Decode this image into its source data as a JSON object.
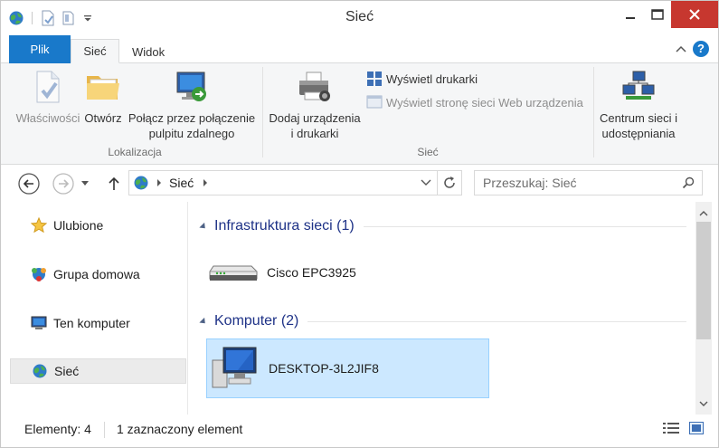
{
  "window": {
    "title": "Sieć"
  },
  "tabs": {
    "file": "Plik",
    "home": "Sieć",
    "view": "Widok"
  },
  "ribbon": {
    "properties": "Właściwości",
    "open": "Otwórz",
    "remote_desktop_line1": "Połącz przez połączenie",
    "remote_desktop_line2": "pulpitu zdalnego",
    "group_location": "Lokalizacja",
    "add_devices_line1": "Dodaj urządzenia",
    "add_devices_line2": "i drukarki",
    "view_printers": "Wyświetl drukarki",
    "view_device_webpage": "Wyświetl stronę sieci Web urządzenia",
    "group_network": "Sieć",
    "network_center_line1": "Centrum sieci i",
    "network_center_line2": "udostępniania"
  },
  "address": {
    "crumb": "Sieć"
  },
  "search": {
    "placeholder": "Przeszukaj: Sieć"
  },
  "navigation": {
    "favorites": "Ulubione",
    "homegroup": "Grupa domowa",
    "this_pc": "Ten komputer",
    "network": "Sieć"
  },
  "content": {
    "groups": [
      {
        "title": "Infrastruktura sieci (1)",
        "items": [
          "Cisco EPC3925"
        ]
      },
      {
        "title": "Komputer (2)",
        "items": [
          "DESKTOP-3L2JIF8"
        ]
      }
    ]
  },
  "status": {
    "count": "Elementy: 4",
    "selected": "1 zaznaczony element"
  },
  "colors": {
    "accent": "#1979ca",
    "selection": "#cce8ff",
    "group_heading": "#1e3287",
    "close_button": "#c7372f"
  }
}
